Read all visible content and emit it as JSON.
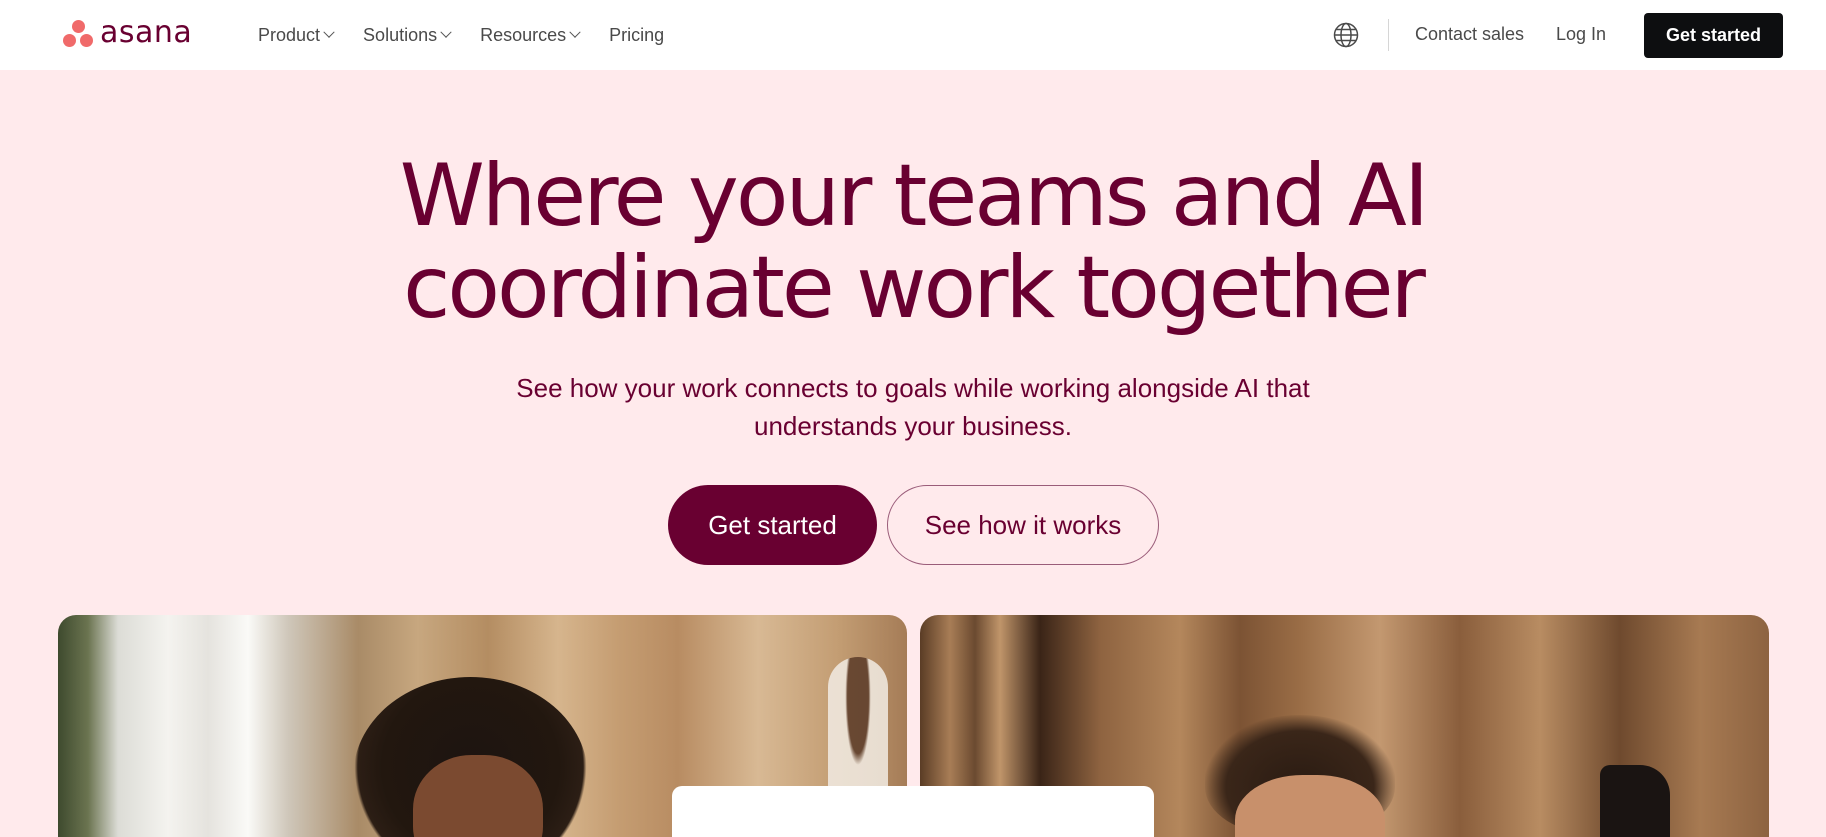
{
  "header": {
    "logo_text": "asana",
    "nav": [
      {
        "label": "Product",
        "has_dropdown": true
      },
      {
        "label": "Solutions",
        "has_dropdown": true
      },
      {
        "label": "Resources",
        "has_dropdown": true
      },
      {
        "label": "Pricing",
        "has_dropdown": false
      }
    ],
    "language_icon": "globe-icon",
    "contact_label": "Contact sales",
    "login_label": "Log In",
    "cta_label": "Get started"
  },
  "hero": {
    "title_line1": "Where your teams and AI",
    "title_line2": "coordinate work together",
    "subtitle_line1": "See how your work connects to goals while working alongside AI that",
    "subtitle_line2": "understands your business.",
    "primary_button": "Get started",
    "secondary_button": "See how it works"
  },
  "colors": {
    "brand_coral": "#f06a6a",
    "brand_plum": "#690031",
    "hero_background": "#ffeaec",
    "header_cta_bg": "#0d0e10"
  }
}
